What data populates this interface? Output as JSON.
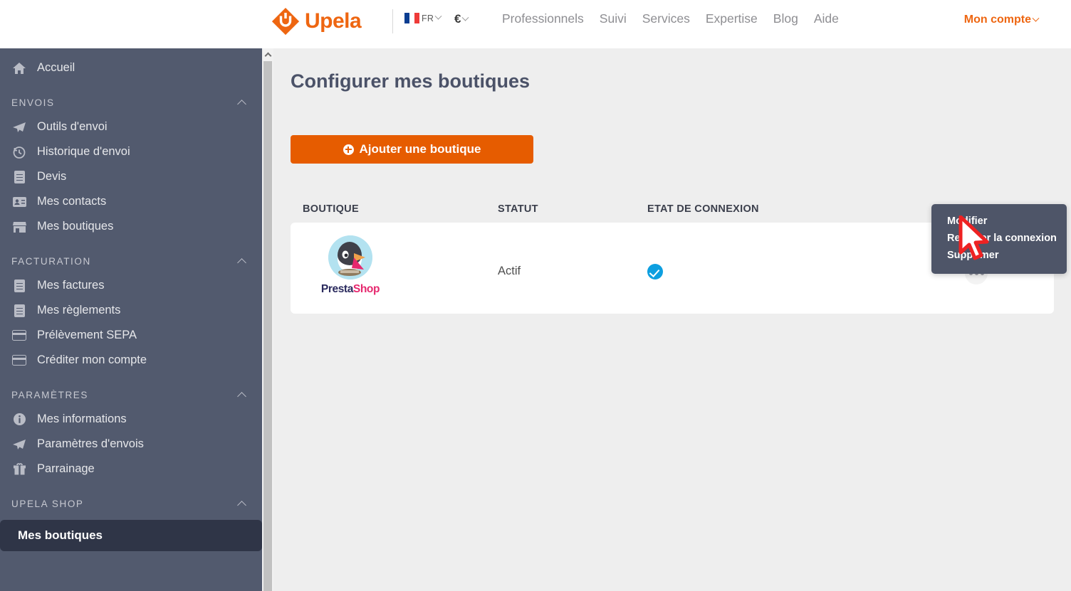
{
  "header": {
    "brand": "Upela",
    "brand_color": "#ee6611",
    "locale": {
      "lang": "FR",
      "currency": "€",
      "flag": "flag-fr-icon"
    },
    "nav": [
      {
        "label": "Professionnels"
      },
      {
        "label": "Suivi"
      },
      {
        "label": "Services"
      },
      {
        "label": "Expertise"
      },
      {
        "label": "Blog"
      },
      {
        "label": "Aide"
      }
    ],
    "account": "Mon compte"
  },
  "sidebar": {
    "home": {
      "label": "Accueil",
      "icon": "home-icon"
    },
    "groups": [
      {
        "title": "ENVOIS",
        "items": [
          {
            "label": "Outils d'envoi",
            "icon": "paper-plane-icon"
          },
          {
            "label": "Historique d'envoi",
            "icon": "history-clock-icon"
          },
          {
            "label": "Devis",
            "icon": "document-icon"
          },
          {
            "label": "Mes contacts",
            "icon": "contact-card-icon"
          },
          {
            "label": "Mes boutiques",
            "icon": "store-icon"
          }
        ]
      },
      {
        "title": "FACTURATION",
        "items": [
          {
            "label": "Mes factures",
            "icon": "document-icon"
          },
          {
            "label": "Mes règlements",
            "icon": "document-icon"
          },
          {
            "label": "Prélèvement SEPA",
            "icon": "credit-card-icon"
          },
          {
            "label": "Créditer mon compte",
            "icon": "credit-card-icon"
          }
        ]
      },
      {
        "title": "PARAMÈTRES",
        "items": [
          {
            "label": "Mes informations",
            "icon": "info-circle-icon"
          },
          {
            "label": "Paramètres d'envois",
            "icon": "paper-plane-icon"
          },
          {
            "label": "Parrainage",
            "icon": "gift-icon"
          }
        ]
      },
      {
        "title": "UPELA SHOP",
        "items": [
          {
            "label": "Mes boutiques",
            "icon": "",
            "active": true
          }
        ]
      }
    ]
  },
  "main": {
    "page_title": "Configurer mes boutiques",
    "add_button": "Ajouter une boutique",
    "table": {
      "columns": [
        "BOUTIQUE",
        "STATUT",
        "ETAT DE CONNEXION"
      ],
      "rows": [
        {
          "boutique": "PrestaShop",
          "boutique_brand_part1": "Presta",
          "boutique_brand_part2": "Shop",
          "statut": "Actif",
          "connexion": "connected-check-icon"
        }
      ]
    }
  },
  "context_menu": {
    "items": [
      {
        "label": "Modifier"
      },
      {
        "label": "Relancer la connexion"
      },
      {
        "label": "Supprimer"
      }
    ]
  },
  "colors": {
    "accent_orange": "#e65c00",
    "sidebar_bg": "#525a6e",
    "sidebar_active_bg": "#2f3547",
    "connected_blue": "#0d9fe0",
    "presta_pink": "#e6286e",
    "presta_navy": "#2b2b5e"
  }
}
